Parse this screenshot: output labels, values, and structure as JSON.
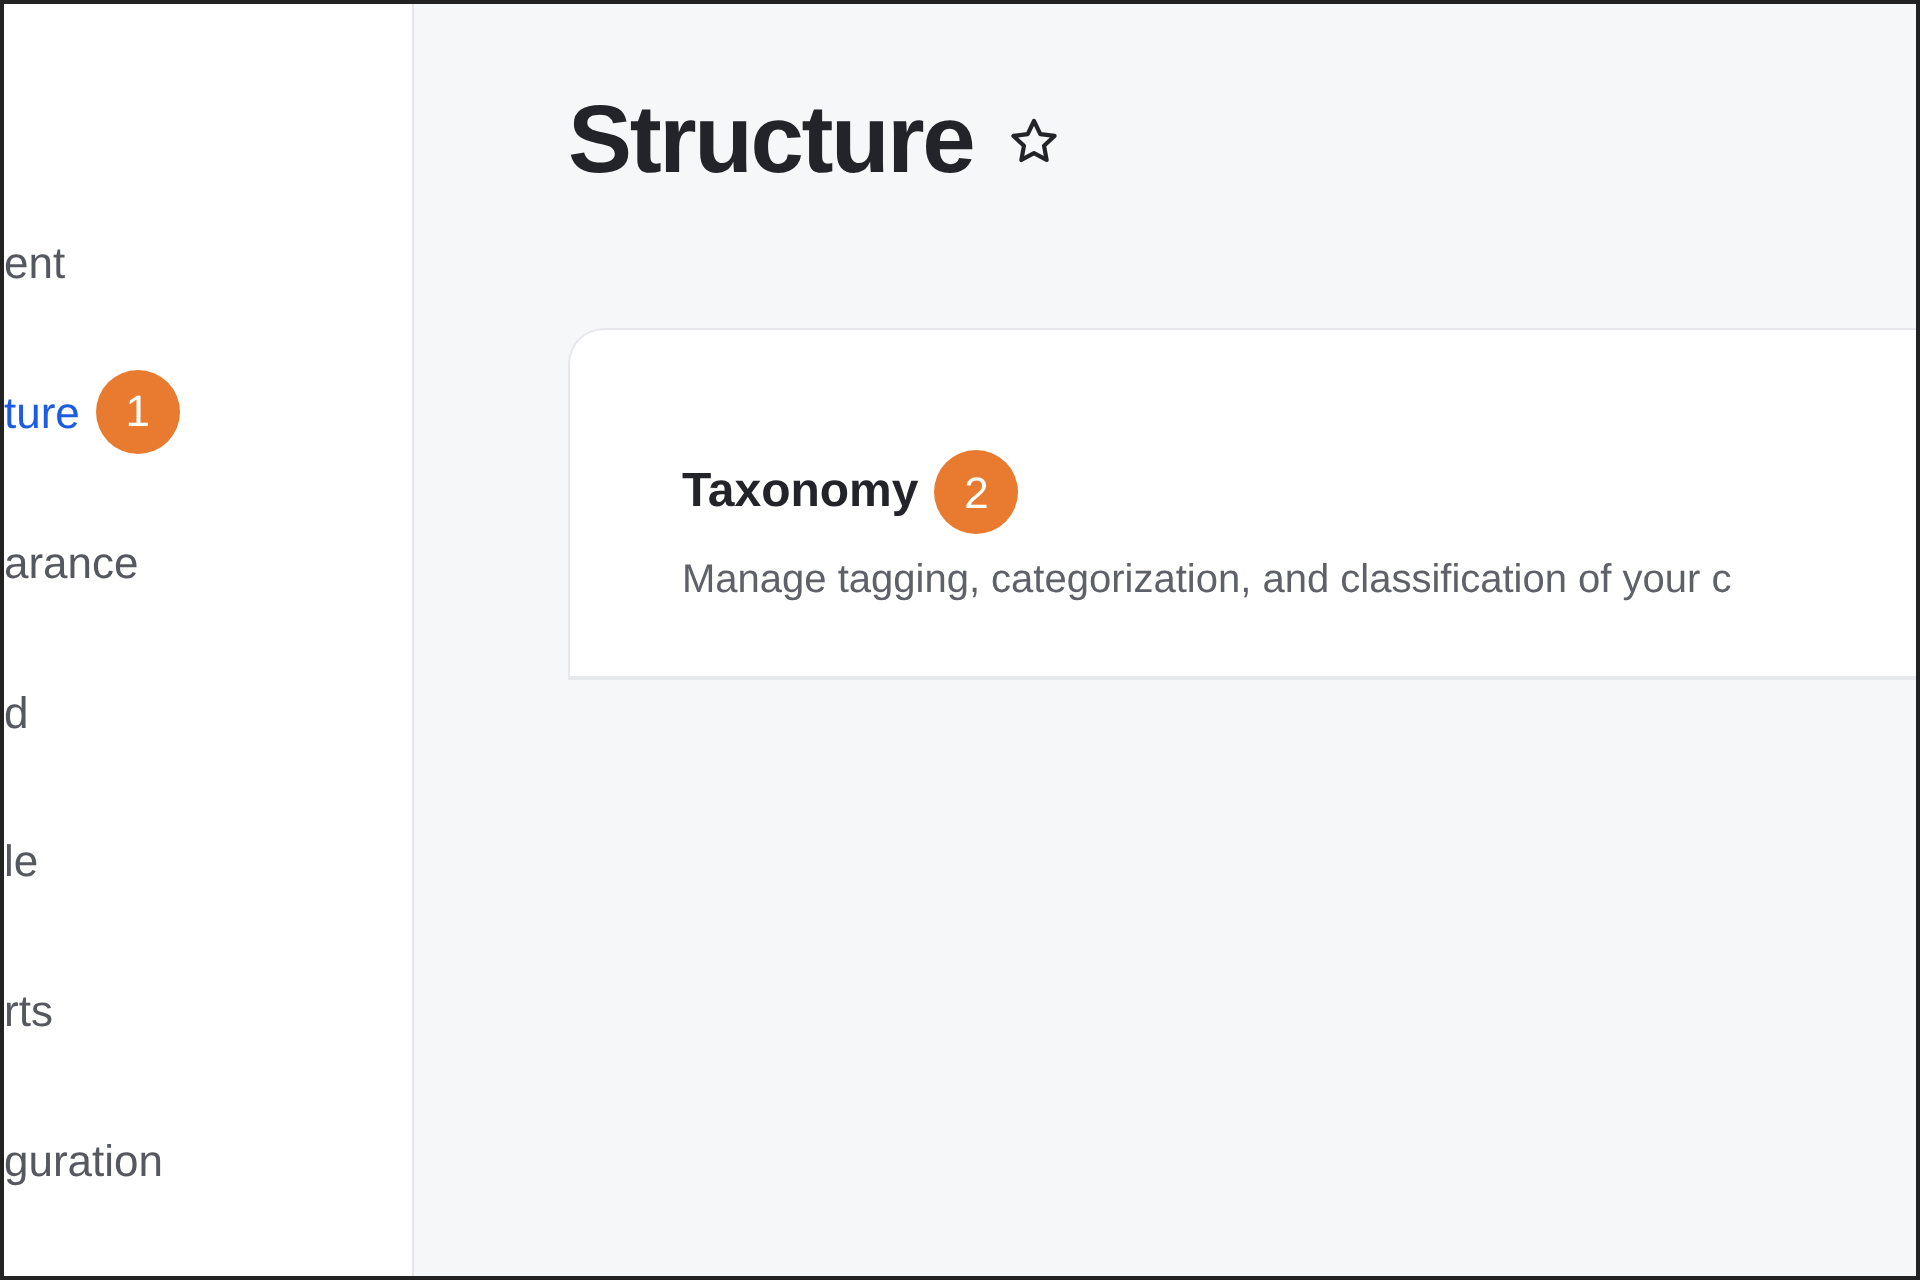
{
  "sidebar": {
    "items": [
      {
        "label": "ent",
        "selected": false
      },
      {
        "label": "ture",
        "selected": true,
        "callout": "1"
      },
      {
        "label": "arance",
        "selected": false
      },
      {
        "label": "d",
        "selected": false
      },
      {
        "label": "le",
        "selected": false
      },
      {
        "label": "rts",
        "selected": false
      },
      {
        "label": "guration",
        "selected": false
      }
    ]
  },
  "page": {
    "title": "Structure",
    "favorite": false
  },
  "cards": [
    {
      "title": "Taxonomy",
      "callout": "2",
      "description": "Manage tagging, categorization, and classification of your c"
    }
  ]
}
